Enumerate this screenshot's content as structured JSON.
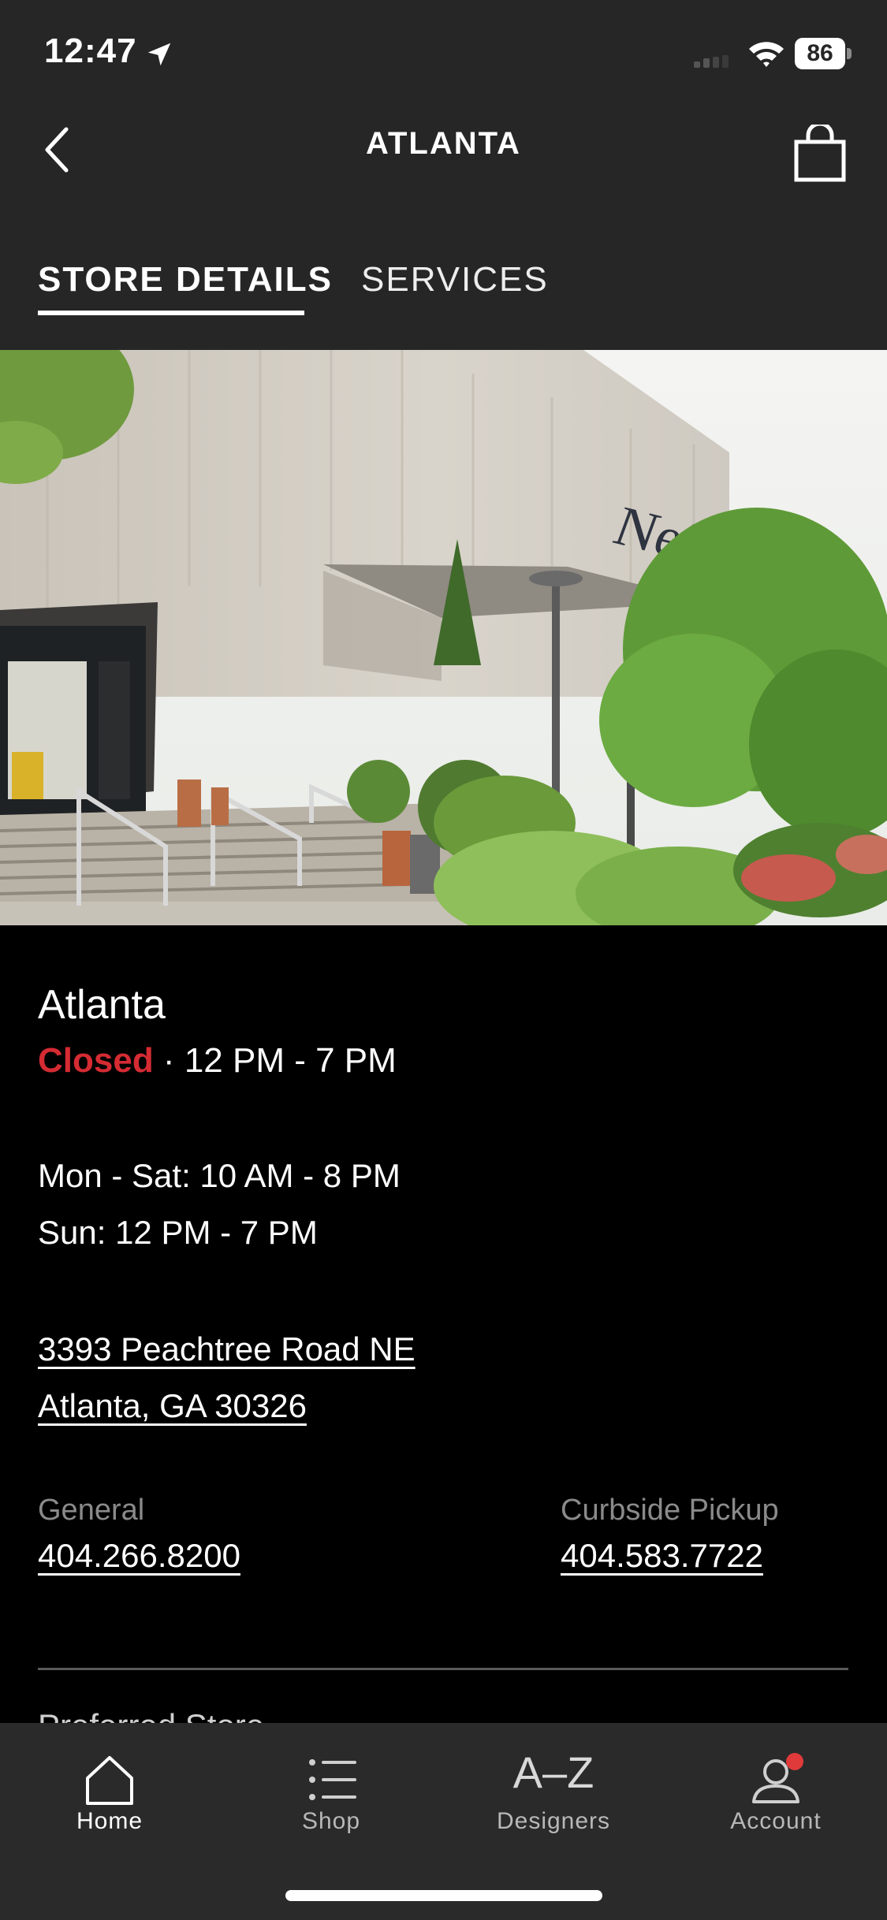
{
  "status_bar": {
    "time": "12:47",
    "battery": "86"
  },
  "nav": {
    "title": "ATLANTA"
  },
  "tabs": [
    {
      "label": "STORE DETAILS"
    },
    {
      "label": "SERVICES"
    }
  ],
  "store": {
    "name": "Atlanta",
    "status": "Closed",
    "status_sep": " · ",
    "today_hours": "12 PM - 7 PM",
    "hours": [
      "Mon - Sat: 10 AM - 8 PM",
      "Sun: 12 PM - 7 PM"
    ],
    "address_line1": "3393 Peachtree Road NE",
    "address_line2": "Atlanta, GA 30326",
    "phones": {
      "general_label": "General",
      "general": "404.266.8200",
      "curbside_label": "Curbside Pickup",
      "curbside": "404.583.7722"
    },
    "next_section_peek": "Preferred Store"
  },
  "tabbar": [
    {
      "label": "Home",
      "icon": "home-icon"
    },
    {
      "label": "Shop",
      "icon": "list-icon"
    },
    {
      "label": "Designers",
      "icon": "a-z-icon",
      "glyph": "A–Z"
    },
    {
      "label": "Account",
      "icon": "account-icon"
    }
  ],
  "colors": {
    "closed": "#d52b33",
    "header_bg": "#262626",
    "badge": "#e03a3a"
  }
}
